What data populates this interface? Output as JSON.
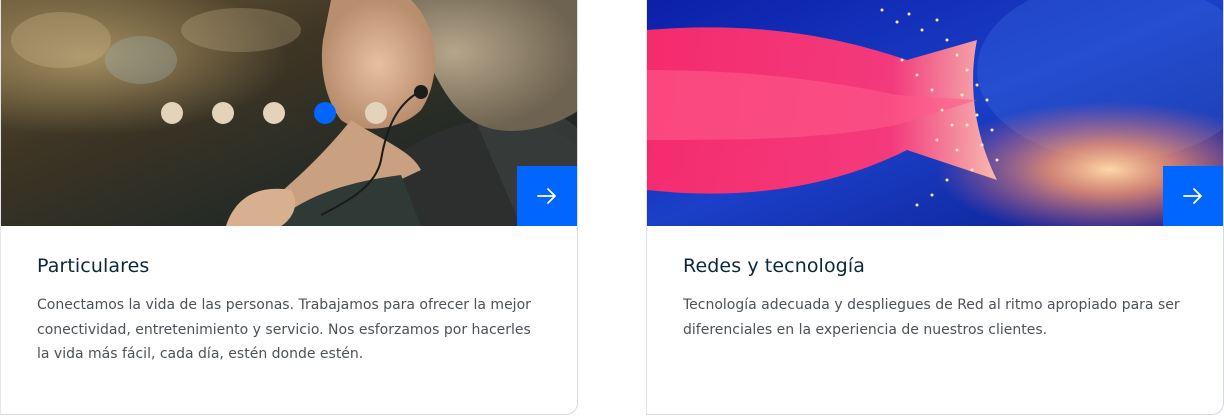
{
  "cards": [
    {
      "title": "Particulares",
      "description": "Conectamos la vida de las personas. Trabajamos para ofrecer la mejor conectividad, entretenimiento y servicio. Nos esforzamos por hacerles la vida más fácil, cada día, estén donde estén.",
      "image": "woman-listening-music-photo",
      "button_icon": "arrow-right-icon"
    },
    {
      "title": "Redes y tecnología",
      "description": "Tecnología adecuada y despliegues de Red al ritmo apropiado para ser diferenciales en la experiencia de nuestros clientes.",
      "image": "fiber-optic-cables-photo",
      "button_icon": "arrow-right-icon"
    }
  ],
  "carousel": {
    "dot_count": 5,
    "active_index": 4
  },
  "colors": {
    "accent": "#0066ff",
    "title": "#0b2739",
    "text": "#4b5258",
    "dot_inactive": "#e4d3bb"
  }
}
